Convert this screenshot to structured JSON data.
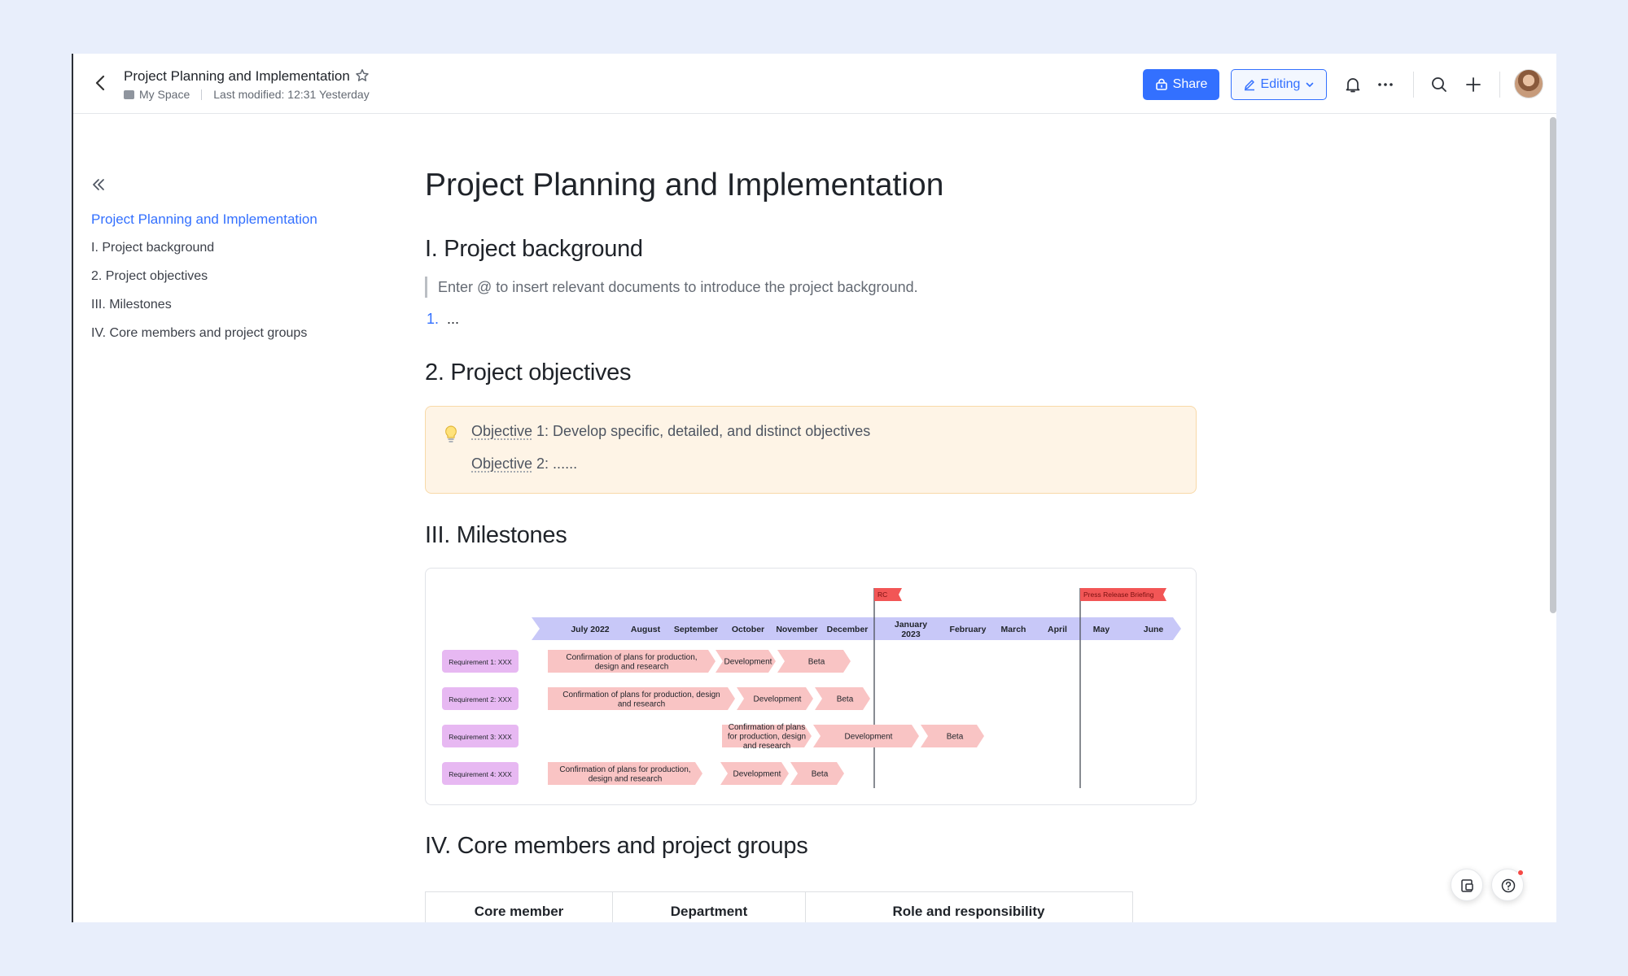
{
  "header": {
    "doc_title": "Project Planning and Implementation",
    "location": "My Space",
    "last_modified": "Last modified: 12:31 Yesterday",
    "share_label": "Share",
    "editing_label": "Editing"
  },
  "outline": {
    "items": [
      "Project Planning and Implementation",
      "I. Project background",
      "2. Project objectives",
      "III. Milestones",
      "IV. Core members and project groups"
    ]
  },
  "document": {
    "title": "Project Planning and Implementation",
    "sections": {
      "background": {
        "heading": "I. Project background",
        "quote": "Enter @ to insert relevant documents to introduce the project background.",
        "list_number": "1.",
        "list_text": "..."
      },
      "objectives": {
        "heading": "2. Project objectives",
        "line1_word": "Objective",
        "line1_rest": " 1: Develop specific, detailed, and distinct objectives",
        "line2_word": "Objective",
        "line2_rest": " 2: ......"
      },
      "milestones": {
        "heading": "III. Milestones"
      },
      "members": {
        "heading": "IV. Core members and project groups",
        "columns": [
          "Core member",
          "Department",
          "Role and responsibility"
        ]
      }
    }
  },
  "timeline": {
    "months": [
      "July 2022",
      "August",
      "September",
      "October",
      "November",
      "December",
      "January 2023",
      "February",
      "March",
      "April",
      "May",
      "June"
    ],
    "flags": [
      "RC",
      "Press Release Briefing"
    ],
    "requirements": [
      "Requirement 1: XXX",
      "Requirement 2: XXX",
      "Requirement 3: XXX",
      "Requirement 4: XXX"
    ],
    "tasks": [
      [
        "Confirmation of plans for production, design and research",
        "Development",
        "Beta"
      ],
      [
        "Confirmation of plans for production, design and research",
        "Development",
        "Beta"
      ],
      [
        "Confirmation of plans for production, design and research",
        "Development",
        "Beta"
      ],
      [
        "Confirmation of plans for production, design and research",
        "Development",
        "Beta"
      ]
    ]
  },
  "colors": {
    "accent": "#3370ff",
    "callout_bg": "#fef4e6",
    "timeline_axis": "#c8c8f8",
    "requirement_tag": "#e7b8f2",
    "task_arrow": "#f9c4c4",
    "flag": "#f25656"
  },
  "icons": {
    "back": "chevron-left-icon",
    "star": "star-icon",
    "folder": "folder-icon",
    "share": "share-lock-icon",
    "edit": "pencil-icon",
    "bell": "bell-icon",
    "more": "more-dots-icon",
    "search": "search-icon",
    "add": "plus-icon",
    "collapse": "double-chevron-left-icon",
    "bulb": "lightbulb-icon",
    "comment": "comment-icon",
    "help": "help-icon"
  }
}
